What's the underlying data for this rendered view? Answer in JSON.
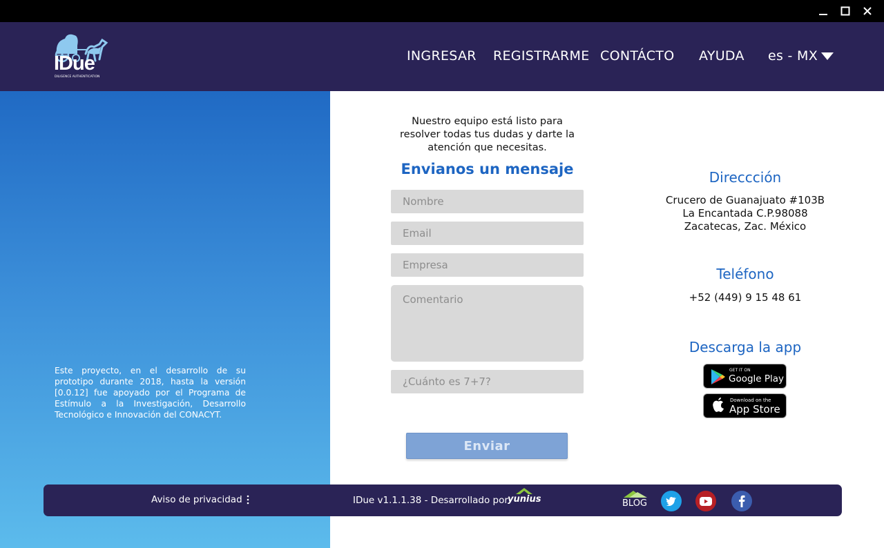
{
  "window": {
    "minimize_icon": "minimize-icon",
    "maximize_icon": "maximize-icon",
    "close_icon": "close-icon"
  },
  "header": {
    "logo_text": "IDue",
    "logo_tagline": "DILIGENCE AUTHENTICATION",
    "nav": {
      "login": "INGRESAR",
      "register": "REGISTRARME",
      "contact": "CONTÁCTO",
      "help": "AYUDA",
      "language": "es - MX"
    }
  },
  "left": {
    "text": "Este proyecto, en el desarrollo de su prototipo durante 2018, hasta la versión [0.0.12] fue apoyado por el Programa de Estímulo a la Investigación, Desarrollo Tecnológico e Innovación del CONACYT."
  },
  "form": {
    "intro": "Nuestro equipo está listo para resolver todas tus dudas y darte la atención que necesitas.",
    "title": "Envianos un mensaje",
    "name_placeholder": "Nombre",
    "email_placeholder": "Email",
    "company_placeholder": "Empresa",
    "comment_placeholder": "Comentario",
    "captcha_placeholder": "¿Cuánto es 7+7?",
    "submit": "Enviar"
  },
  "info": {
    "address_title": "Direccción",
    "address_lines": [
      "Crucero de Guanajuato #103B",
      "La Encantada C.P.98088",
      "Zacatecas, Zac. México"
    ],
    "phone_title": "Teléfono",
    "phone": "+52 (449) 9 15 48 61",
    "app_title": "Descarga la app",
    "google_play": {
      "small": "GET IT ON",
      "big": "Google Play"
    },
    "app_store": {
      "small": "Download on the",
      "big": "App Store"
    }
  },
  "footer": {
    "privacy": "Aviso de privacidad",
    "version": "IDue v1.1.1.38 - Desarrollado por",
    "dev_brand": "yunius",
    "blog": "BLOG"
  },
  "colors": {
    "header_bg": "#2a2356",
    "accent": "#1d65c2",
    "field_bg": "#d9d9d9",
    "button_bg": "#7ea3d6"
  }
}
